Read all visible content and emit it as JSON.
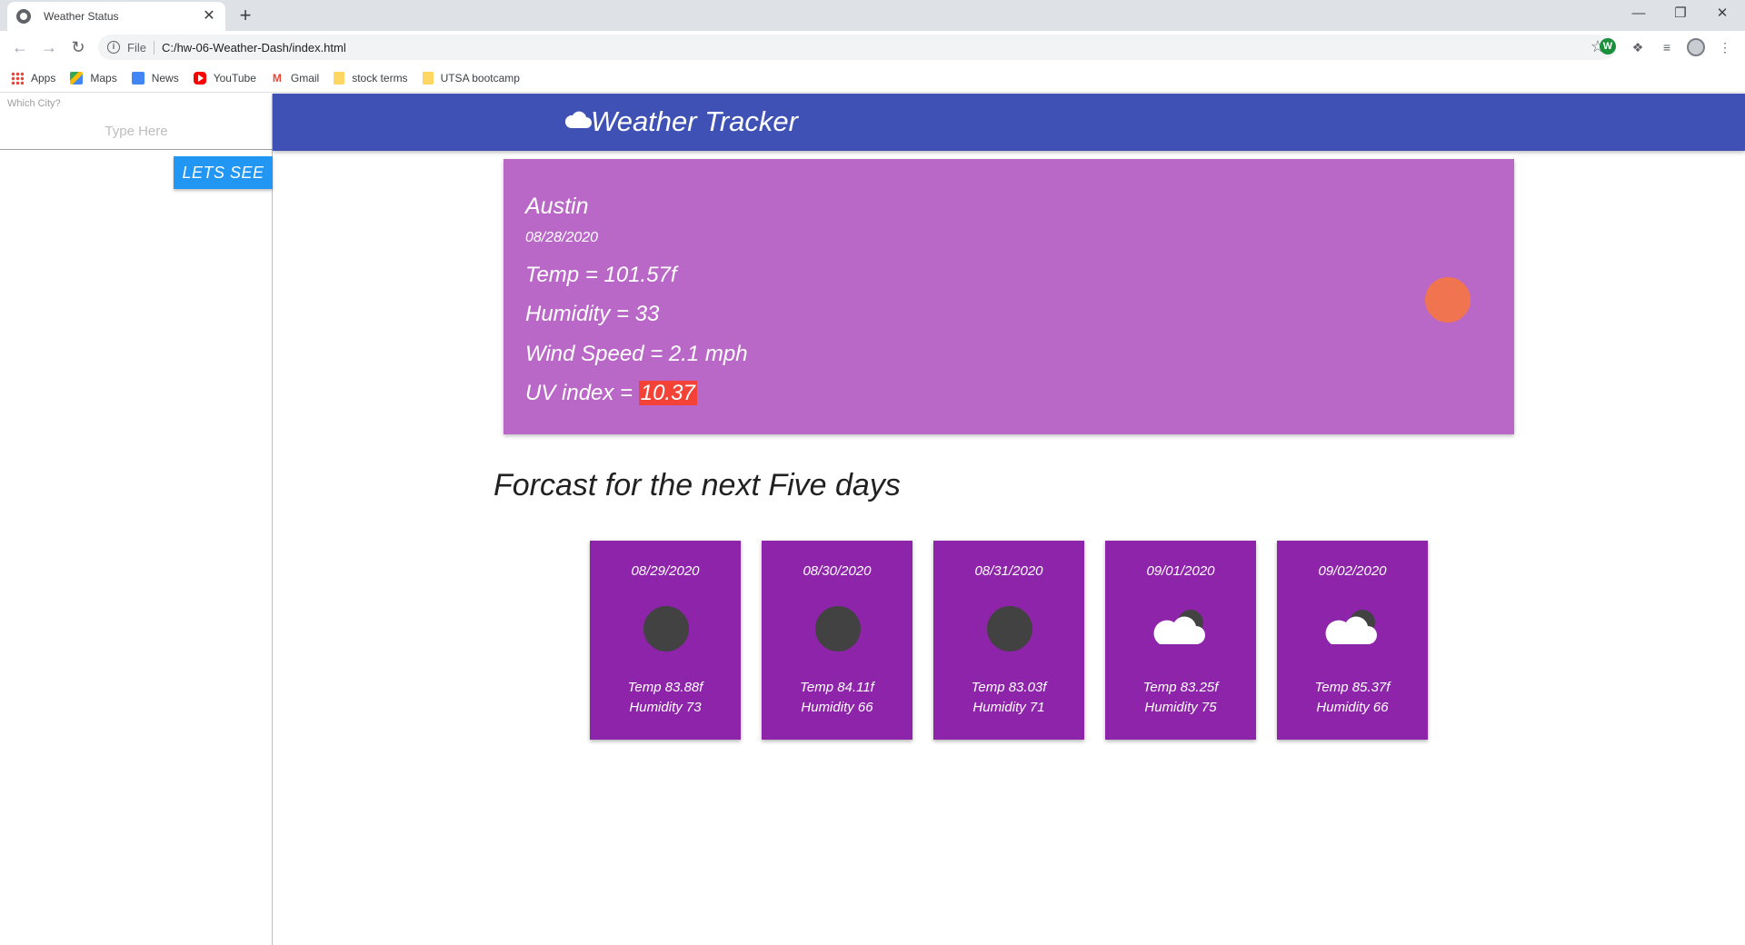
{
  "browser": {
    "tab_title": "Weather Status",
    "address_scheme": "File",
    "address_url": "C:/hw-06-Weather-Dash/index.html",
    "bookmarks": [
      {
        "label": "Apps",
        "icon": "apps-icon"
      },
      {
        "label": "Maps",
        "icon": "maps-icon"
      },
      {
        "label": "News",
        "icon": "news-icon"
      },
      {
        "label": "YouTube",
        "icon": "youtube-icon"
      },
      {
        "label": "Gmail",
        "icon": "gmail-icon"
      },
      {
        "label": "stock terms",
        "icon": "folder-icon"
      },
      {
        "label": "UTSA bootcamp",
        "icon": "folder-icon"
      }
    ]
  },
  "sidebar": {
    "label": "Which City?",
    "input_placeholder": "Type Here",
    "input_value": "",
    "button_label": "LETS SEE"
  },
  "header": {
    "title": "Weather Tracker",
    "icon": "cloud-icon"
  },
  "current": {
    "city": "Austin",
    "date": "08/28/2020",
    "temp": "Temp = 101.57f",
    "humidity": "Humidity = 33",
    "wind": "Wind Speed = 2.1 mph",
    "uv_label": "UV index = ",
    "uv_value": "10.37",
    "icon": "sun-icon"
  },
  "forecast": {
    "heading": "Forcast for the next Five days",
    "days": [
      {
        "date": "08/29/2020",
        "icon": "moon-icon",
        "temp": "Temp 83.88f",
        "humidity": "Humidity 73"
      },
      {
        "date": "08/30/2020",
        "icon": "moon-icon",
        "temp": "Temp 84.11f",
        "humidity": "Humidity 66"
      },
      {
        "date": "08/31/2020",
        "icon": "moon-icon",
        "temp": "Temp 83.03f",
        "humidity": "Humidity 71"
      },
      {
        "date": "09/01/2020",
        "icon": "cloud-night-icon",
        "temp": "Temp 83.25f",
        "humidity": "Humidity 75"
      },
      {
        "date": "09/02/2020",
        "icon": "cloud-night-icon",
        "temp": "Temp 85.37f",
        "humidity": "Humidity 66"
      }
    ]
  },
  "colors": {
    "header": "#3f51b5",
    "current_card": "#ba68c8",
    "forecast_card": "#8e24aa",
    "uv_high": "#f44336",
    "button": "#2196f3"
  }
}
